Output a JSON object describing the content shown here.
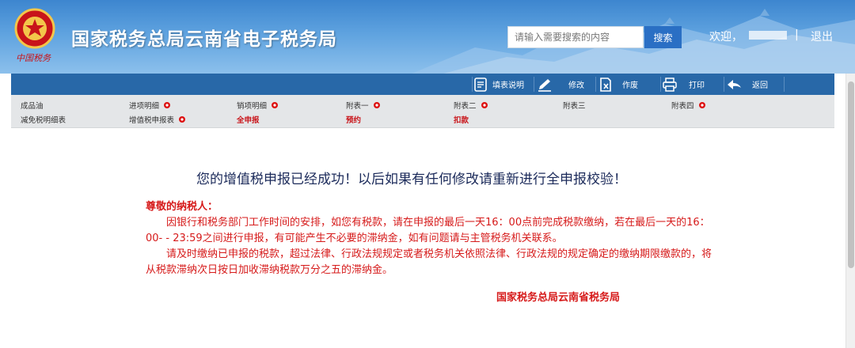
{
  "header": {
    "site_title": "国家税务总局云南省电子税务局",
    "emblem_script": "中国税务",
    "search_placeholder": "请输入需要搜索的内容",
    "search_button": "搜索",
    "welcome": "欢迎，",
    "separator": "|",
    "logout": "退出"
  },
  "toolbar": {
    "items": [
      {
        "label": "填表说明",
        "icon": "document-icon"
      },
      {
        "label": "修改",
        "icon": "pen-icon"
      },
      {
        "label": "作废",
        "icon": "void-icon"
      },
      {
        "label": "打印",
        "icon": "printer-icon"
      },
      {
        "label": "返回",
        "icon": "back-arrow-icon"
      }
    ]
  },
  "tabs": {
    "row1": [
      "成品油",
      "进项明细",
      "销项明细",
      "附表一",
      "附表二",
      "附表三",
      "附表四"
    ],
    "row2": [
      "减免税明细表",
      "增值税申报表",
      "全申报",
      "预约",
      "扣款"
    ]
  },
  "main": {
    "headline": "您的增值税申报已经成功！以后如果有任何修改请重新进行全申报校验！",
    "salutation": "尊敬的纳税人：",
    "paragraph1": "因银行和税务部门工作时间的安排，如您有税款，请在申报的最后一天16：00点前完成税款缴纳，若在最后一天的16：00- - 23:59之间进行申报，有可能产生不必要的滞纳金，如有问题请与主管税务机关联系。",
    "paragraph2": "请及时缴纳已申报的税款，超过法律、行政法规规定或者税务机关依照法律、行政法规的规定确定的缴纳期限缴款的，将从税款滞纳次日按日加收滞纳税款万分之五的滞纳金。",
    "signature": "国家税务总局云南省税务局"
  },
  "colors": {
    "header_blue": "#3d86cf",
    "toolbar_blue": "#2868a8",
    "notice_red": "#d61a1a",
    "tab_strip": "#e4e6e8"
  }
}
